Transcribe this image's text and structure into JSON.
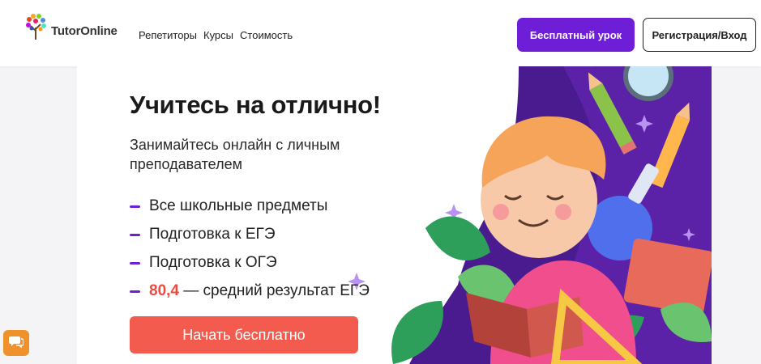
{
  "header": {
    "logo_text": "TutorOnline",
    "nav": [
      {
        "label": "Репетиторы"
      },
      {
        "label": "Курсы"
      },
      {
        "label": "Стоимость"
      }
    ],
    "free_lesson_label": "Бесплатный урок",
    "register_label": "Регистрация/Вход"
  },
  "hero": {
    "title": "Учитесь на отлично!",
    "subtitle": "Занимайтесь онлайн с личным преподавателем",
    "features": [
      {
        "text": "Все школьные предметы"
      },
      {
        "text": "Подготовка к ЕГЭ"
      },
      {
        "text": "Подготовка к ОГЭ"
      },
      {
        "stat": "80,4",
        "text": " — средний результат ЕГЭ"
      }
    ],
    "cta_label": "Начать бесплатно"
  },
  "colors": {
    "brand_purple": "#6d1ed6",
    "cta_red": "#f25b4d",
    "stat_red": "#f04a3e",
    "chat_orange": "#f0922b"
  },
  "icons": {
    "chat": "chat-icon",
    "logo": "tree-logo-icon"
  }
}
